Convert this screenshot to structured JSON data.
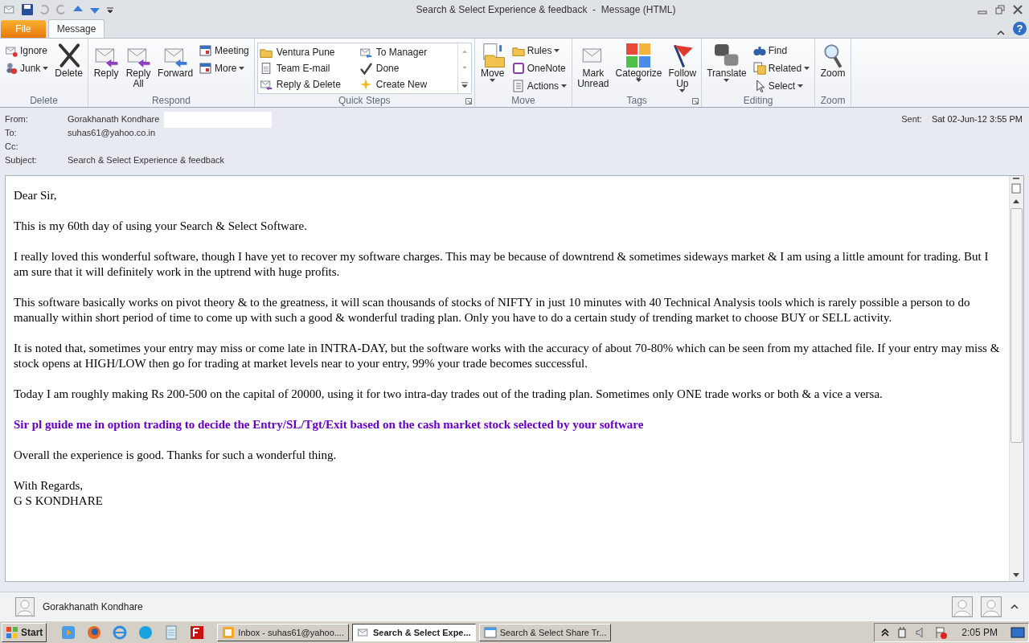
{
  "window": {
    "title": "Search & Select Experience & feedback  -  Message (HTML)",
    "help": "?"
  },
  "tabs": [
    {
      "label": "File",
      "kind": "file",
      "selected": false
    },
    {
      "label": "Message",
      "kind": "tab",
      "selected": true
    }
  ],
  "ribbon": [
    {
      "label": "Delete",
      "launcher": false,
      "items": [
        {
          "kind": "column",
          "buttons": [
            {
              "label": "Ignore",
              "dropdown": false
            },
            {
              "label": "Junk",
              "dropdown": true
            }
          ]
        },
        {
          "kind": "large",
          "label": "Delete",
          "dropdown": false
        }
      ]
    },
    {
      "label": "Respond",
      "launcher": false,
      "items": [
        {
          "kind": "large",
          "label": "Reply",
          "dropdown": false
        },
        {
          "kind": "large",
          "label": "Reply All",
          "dropdown": false
        },
        {
          "kind": "large",
          "label": "Forward",
          "dropdown": false
        },
        {
          "kind": "column",
          "buttons": [
            {
              "label": "Meeting",
              "dropdown": false
            },
            {
              "label": "More",
              "dropdown": true
            }
          ]
        }
      ]
    },
    {
      "label": "Quick Steps",
      "launcher": true,
      "items": [
        {
          "kind": "gallery",
          "columns": [
            [
              "Ventura Pune",
              "Team E-mail",
              "Reply & Delete"
            ],
            [
              "To Manager",
              "Done",
              "Create New"
            ]
          ]
        }
      ]
    },
    {
      "label": "Move",
      "launcher": false,
      "items": [
        {
          "kind": "large",
          "label": "Move",
          "dropdown": true
        },
        {
          "kind": "column",
          "buttons": [
            {
              "label": "Rules",
              "dropdown": true
            },
            {
              "label": "OneNote",
              "dropdown": false
            },
            {
              "label": "Actions",
              "dropdown": true
            }
          ]
        }
      ]
    },
    {
      "label": "Tags",
      "launcher": true,
      "items": [
        {
          "kind": "large",
          "label": "Mark Unread",
          "dropdown": false
        },
        {
          "kind": "large",
          "label": "Categorize",
          "dropdown": true
        },
        {
          "kind": "large",
          "label": "Follow Up",
          "dropdown": true
        }
      ]
    },
    {
      "label": "Editing",
      "launcher": false,
      "items": [
        {
          "kind": "large",
          "label": "Translate",
          "dropdown": true
        },
        {
          "kind": "column",
          "buttons": [
            {
              "label": "Find",
              "dropdown": false
            },
            {
              "label": "Related",
              "dropdown": true
            },
            {
              "label": "Select",
              "dropdown": true
            }
          ]
        }
      ]
    },
    {
      "label": "Zoom",
      "launcher": false,
      "items": [
        {
          "kind": "large",
          "label": "Zoom",
          "dropdown": false
        }
      ]
    }
  ],
  "header": {
    "from_label": "From:",
    "from": "Gorakhanath Kondhare",
    "to_label": "To:",
    "to": "suhas61@yahoo.co.in",
    "cc_label": "Cc:",
    "subject_label": "Subject:",
    "subject": "Search & Select Experience & feedback",
    "sent_label": "Sent:",
    "sent": "Sat 02-Jun-12 3:55 PM"
  },
  "body": [
    {
      "kind": "normal",
      "lines": [
        "Dear Sir,"
      ]
    },
    {
      "kind": "normal",
      "lines": [
        "This is my 60th day of using your Search & Select Software."
      ]
    },
    {
      "kind": "normal",
      "lines": [
        "I really loved this wonderful software, though I have yet to recover my software charges. This may be because of downtrend & sometimes sideways market & I am using a little amount for trading. But I am sure that it will definitely work in the uptrend with huge profits."
      ]
    },
    {
      "kind": "normal",
      "lines": [
        "This software basically works on pivot theory & to the greatness, it will scan thousands of stocks of NIFTY in just 10 minutes with 40 Technical Analysis tools which is rarely possible a person to do manually within short period of time to come up with such a good & wonderful trading plan. Only you have to do a certain study of trending market to choose BUY or SELL activity."
      ]
    },
    {
      "kind": "normal",
      "lines": [
        "It is noted that, sometimes your entry may miss or come late in INTRA-DAY, but the software works with the accuracy of about 70-80% which can be seen from my attached file. If your entry may miss & stock opens at HIGH/LOW then go for trading at market levels near to your entry, 99% your trade becomes successful."
      ]
    },
    {
      "kind": "normal",
      "lines": [
        "Today I am roughly making Rs 200-500 on the capital of 20000, using it for two intra-day trades out of the trading plan. Sometimes only ONE trade works or both & a vice a versa."
      ]
    },
    {
      "kind": "highlight",
      "lines": [
        "Sir pl guide me in option trading to decide the Entry/SL/Tgt/Exit based on the cash market stock selected by your software"
      ]
    },
    {
      "kind": "normal",
      "lines": [
        "Overall the experience is good. Thanks for such a wonderful thing."
      ]
    },
    {
      "kind": "normal",
      "lines": [
        "With Regards,",
        "G S KONDHARE"
      ]
    }
  ],
  "people_pane": {
    "name": "Gorakhanath Kondhare"
  },
  "taskbar": {
    "start": "Start",
    "tasks": [
      {
        "label": "Inbox - suhas61@yahoo....",
        "selected": false
      },
      {
        "label": "Search & Select Expe...",
        "selected": true
      },
      {
        "label": "Search & Select Share Tr...",
        "selected": false
      }
    ],
    "clock": "2:05 PM"
  }
}
